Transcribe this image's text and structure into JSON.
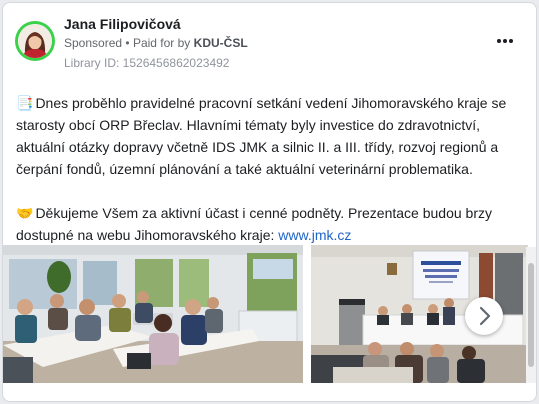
{
  "post": {
    "author": "Jana Filipovičová",
    "sponsored_label": "Sponsored",
    "paid_for_prefix": "Paid for by",
    "paid_for_by": "KDU-ČSL",
    "library_id": "Library ID: 1526456862023492"
  },
  "content": {
    "paragraph1_emoji": "📑",
    "paragraph1": "Dnes proběhlo pravidelné pracovní setkání vedení Jihomoravského kraje se starosty obcí ORP Břeclav. Hlavními tématy byly investice do zdravotnictví, aktuální otázky dopravy včetně IDS JMK a silnic II. a III. třídy, rozvoj regionů a čerpání fondů, územní plánování a také aktuální veterinární problematika.",
    "paragraph2_emoji": "🤝",
    "paragraph2": "Děkujeme Všem za aktivní účast i cenné podněty. Prezentace budou brzy dostupné na webu Jihomoravského kraje: ",
    "link": "www.jmk.cz"
  },
  "carousel": {
    "next_icon": "chevron-right-icon",
    "photo1": "meeting-room-photo",
    "photo2": "presentation-hall-photo"
  },
  "colors": {
    "avatar_ring": "#3bd14a",
    "link": "#1f64c8"
  }
}
